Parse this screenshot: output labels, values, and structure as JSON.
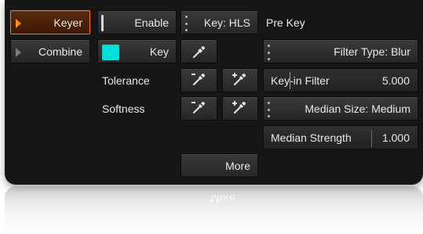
{
  "sidebar": {
    "items": [
      {
        "label": "Keyer",
        "active": true
      },
      {
        "label": "Combine",
        "active": false
      }
    ]
  },
  "row1": {
    "enable_label": "Enable",
    "key_mode_label": "Key: HLS",
    "section_title": "Pre Key"
  },
  "row2": {
    "key_label": "Key",
    "key_color": "#00e0d8",
    "filter_type_label": "Filter Type: Blur"
  },
  "row3": {
    "tolerance_label": "Tolerance",
    "keyin_filter_label": "Key-in Filter",
    "keyin_filter_value": "5.000"
  },
  "row4": {
    "softness_label": "Softness",
    "median_size_label": "Median Size: Medium"
  },
  "row5": {
    "median_strength_label": "Median Strength",
    "median_strength_value": "1.000"
  },
  "more_label": "More",
  "colors": {
    "accent": "#ff7a1a",
    "panel_bg": "#161616",
    "button_bg": "#2e2e2e"
  },
  "icons": {
    "eyedropper": "eyedropper-icon",
    "eyedropper_minus": "eyedropper-minus-icon",
    "eyedropper_plus": "eyedropper-plus-icon"
  }
}
